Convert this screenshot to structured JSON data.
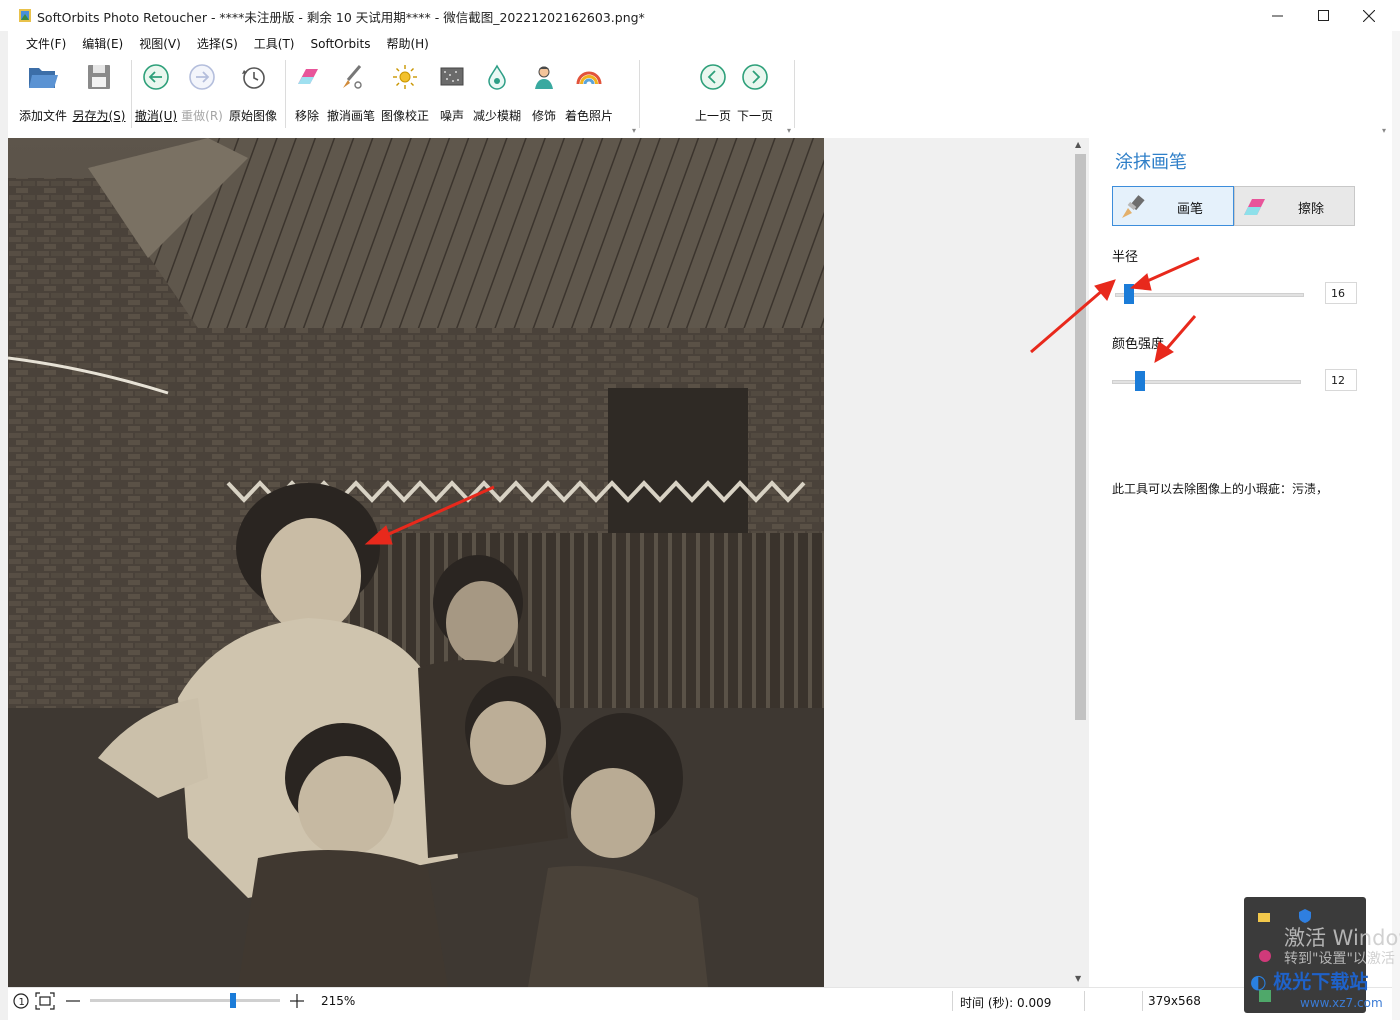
{
  "window": {
    "title": "SoftOrbits Photo Retoucher - ****未注册版 - 剩余 10 天试用期**** - 微信截图_20221202162603.png*",
    "controls": [
      "minimize",
      "maximize",
      "close"
    ]
  },
  "menu": [
    "文件(F)",
    "编辑(E)",
    "视图(V)",
    "选择(S)",
    "工具(T)",
    "SoftOrbits",
    "帮助(H)"
  ],
  "toolbar": {
    "add_file": "添加文件",
    "save_as": "另存为(S)",
    "undo": "撤消(U)",
    "redo": "重做(R)",
    "original": "原始图像",
    "remove": "移除",
    "undo_brush": "撤消画笔",
    "image_correct": "图像校正",
    "noise": "噪声",
    "reduce_blur": "减少模糊",
    "retouch": "修饰",
    "colorize": "着色照片",
    "prev": "上一页",
    "next": "下一页"
  },
  "panel": {
    "title": "涂抹画笔",
    "brush_label": "画笔",
    "erase_label": "擦除",
    "radius_label": "半径",
    "radius_value": "16",
    "radius_fraction": 0.05,
    "intensity_label": "颜色强度",
    "intensity_value": "12",
    "intensity_fraction": 0.13,
    "description": "此工具可以去除图像上的小瑕疵：污渍，"
  },
  "status": {
    "zoom": "215%",
    "zoom_fraction": 0.76,
    "time": "时间 (秒): 0.009",
    "dimensions": "379x568"
  },
  "overlay": {
    "activate_line1": "激活 Window",
    "activate_line2": "转到\"设置\"以激活",
    "site_logo": "极光下载站",
    "site_url": "www.xz7.com"
  },
  "colors": {
    "accent": "#1b7cd8",
    "panel_title": "#2f7fc8",
    "arrow": "#e8291c"
  }
}
